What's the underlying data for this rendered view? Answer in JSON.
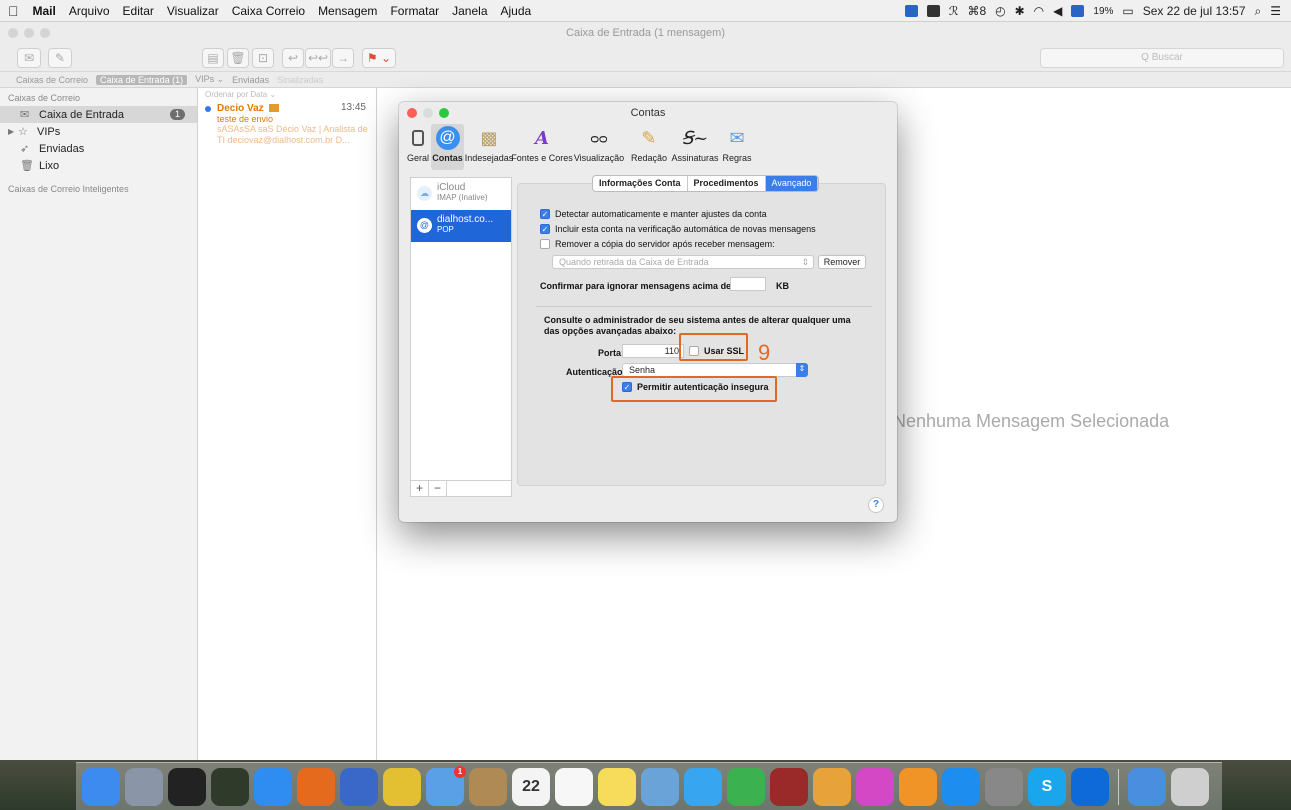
{
  "menubar": {
    "apple": "",
    "app": "Mail",
    "items": [
      "Arquivo",
      "Editar",
      "Visualizar",
      "Caixa Correio",
      "Mensagem",
      "Formatar",
      "Janela",
      "Ajuda"
    ],
    "status": {
      "battery": "19%",
      "datetime": "Sex 22 de jul 13:57"
    }
  },
  "window": {
    "title": "Caixa de Entrada (1 mensagem)",
    "search_placeholder": "Q Buscar"
  },
  "favorites": {
    "mailboxes": "Caixas de Correio",
    "inbox": "Caixa de Entrada (1)",
    "vips": "VIPs ⌄",
    "sent": "Enviadas",
    "flagged": "Sinalizadas"
  },
  "sidebar": {
    "header": "Caixas de Correio",
    "items": [
      {
        "label": "Caixa de Entrada",
        "badge": "1"
      },
      {
        "label": "VIPs"
      },
      {
        "label": "Enviadas"
      },
      {
        "label": "Lixo"
      }
    ],
    "smart_header": "Caixas de Correio Inteligentes"
  },
  "messages": {
    "sort": "Ordenar por Data ⌄",
    "list": [
      {
        "from": "Decio Vaz",
        "time": "13:45",
        "subject": "teste de envio",
        "preview": "sASAsSA saS Décio Vaz | Analista de TI deciovaz@dialhost.com.br D..."
      }
    ]
  },
  "no_selection": "Nenhuma Mensagem Selecionada",
  "prefs": {
    "title": "Contas",
    "tabs": [
      {
        "label": "Geral",
        "icon": "switch-icon"
      },
      {
        "label": "Contas",
        "icon": "at-icon"
      },
      {
        "label": "Indesejadas",
        "icon": "junk-icon"
      },
      {
        "label": "Fontes e Cores",
        "icon": "fonts-icon"
      },
      {
        "label": "Visualização",
        "icon": "glasses-icon"
      },
      {
        "label": "Redação",
        "icon": "pencil-icon"
      },
      {
        "label": "Assinaturas",
        "icon": "signature-icon"
      },
      {
        "label": "Regras",
        "icon": "rules-icon"
      }
    ],
    "accounts": [
      {
        "name": "iCloud",
        "type": "IMAP (Inative)"
      },
      {
        "name": "dialhost.co...",
        "type": "POP"
      }
    ],
    "segments": [
      "Informações Conta",
      "Procedimentos",
      "Avançado"
    ],
    "checks": [
      {
        "label": "Detectar automaticamente e manter ajustes da conta",
        "checked": true
      },
      {
        "label": "Incluir esta conta na verificação automática de novas mensagens",
        "checked": true
      },
      {
        "label": "Remover a cópia do servidor após receber mensagem:",
        "checked": false
      }
    ],
    "remove_popup": "Quando retirada da Caixa de Entrada",
    "remove_button": "Remover",
    "confirm_label": "Confirmar para ignorar mensagens acima de",
    "confirm_unit": "KB",
    "advisory": "Consulte o administrador de seu sistema antes de alterar qualquer uma das opções avançadas abaixo:",
    "port_label": "Porta:",
    "port_value": "110",
    "ssl_label": "Usar SSL",
    "ssl_checked": false,
    "auth_label": "Autenticação:",
    "auth_value": "Senha",
    "insecure_label": "Permitir autenticação insegura",
    "insecure_checked": true,
    "annotation": "9",
    "help": "?",
    "add": "+",
    "remove": "−"
  },
  "dock": {
    "apps": [
      {
        "name": "finder-icon",
        "color": "#3d8bef"
      },
      {
        "name": "launchpad-icon",
        "color": "#8a96a8"
      },
      {
        "name": "terminal-icon",
        "color": "#222222"
      },
      {
        "name": "activity-icon",
        "color": "#2f3a2a"
      },
      {
        "name": "safari-icon",
        "color": "#2f8cf0"
      },
      {
        "name": "firefox-icon",
        "color": "#e66a1d"
      },
      {
        "name": "thunderbird-icon",
        "color": "#3a68c8"
      },
      {
        "name": "chrome-icon",
        "color": "#e2c032"
      },
      {
        "name": "mail-icon",
        "color": "#5aa0e6",
        "badge": "1"
      },
      {
        "name": "contacts-icon",
        "color": "#b08a55"
      },
      {
        "name": "calendar-icon",
        "color": "#f4f4f4",
        "text": "22"
      },
      {
        "name": "reminders-icon",
        "color": "#f7f7f7"
      },
      {
        "name": "notes-icon",
        "color": "#f6dc5a"
      },
      {
        "name": "preview-icon",
        "color": "#6aa3d8"
      },
      {
        "name": "messages-icon",
        "color": "#37a5f0"
      },
      {
        "name": "facetime-icon",
        "color": "#3bb14f"
      },
      {
        "name": "photobooth-icon",
        "color": "#9a2a2a"
      },
      {
        "name": "photos-icon",
        "color": "#e7a23a"
      },
      {
        "name": "itunes-icon",
        "color": "#d447c5"
      },
      {
        "name": "books-icon",
        "color": "#f09428"
      },
      {
        "name": "appstore-icon",
        "color": "#1d8df0"
      },
      {
        "name": "systemprefs-icon",
        "color": "#888888"
      },
      {
        "name": "skype-icon",
        "color": "#1aa6ec",
        "text": "S"
      },
      {
        "name": "teamviewer-icon",
        "color": "#0e6ad8"
      }
    ],
    "extra": [
      {
        "name": "downloads-icon",
        "color": "#4a8ee0"
      },
      {
        "name": "trash-icon",
        "color": "#cfcfcf"
      }
    ]
  }
}
